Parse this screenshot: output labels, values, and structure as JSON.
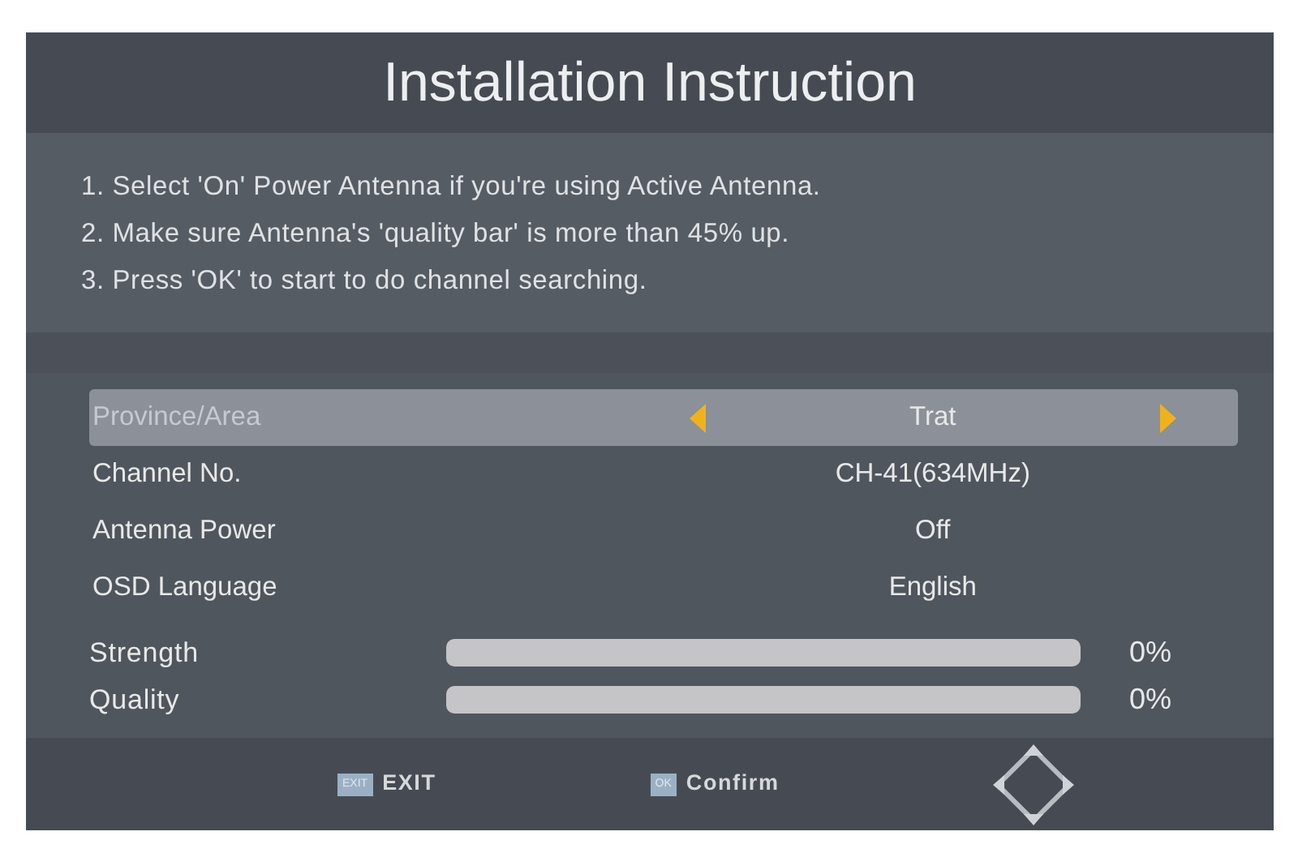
{
  "title": "Installation Instruction",
  "instructions": [
    "1. Select 'On' Power Antenna if you're using Active Antenna.",
    "2. Make sure Antenna's 'quality bar' is more than 45% up.",
    "3. Press 'OK' to start to do channel searching."
  ],
  "settings": [
    {
      "label": "Province/Area",
      "value": "Trat",
      "selected": true
    },
    {
      "label": "Channel No.",
      "value": "CH-41(634MHz)",
      "selected": false
    },
    {
      "label": "Antenna Power",
      "value": "Off",
      "selected": false
    },
    {
      "label": "OSD Language",
      "value": "English",
      "selected": false
    }
  ],
  "meters": [
    {
      "label": "Strength",
      "level": 0,
      "reading": "0%"
    },
    {
      "label": "Quality",
      "level": 0,
      "reading": "0%"
    }
  ],
  "hints": [
    {
      "key": "EXIT",
      "text": "EXIT"
    },
    {
      "key": "OK",
      "text": "Confirm"
    }
  ]
}
